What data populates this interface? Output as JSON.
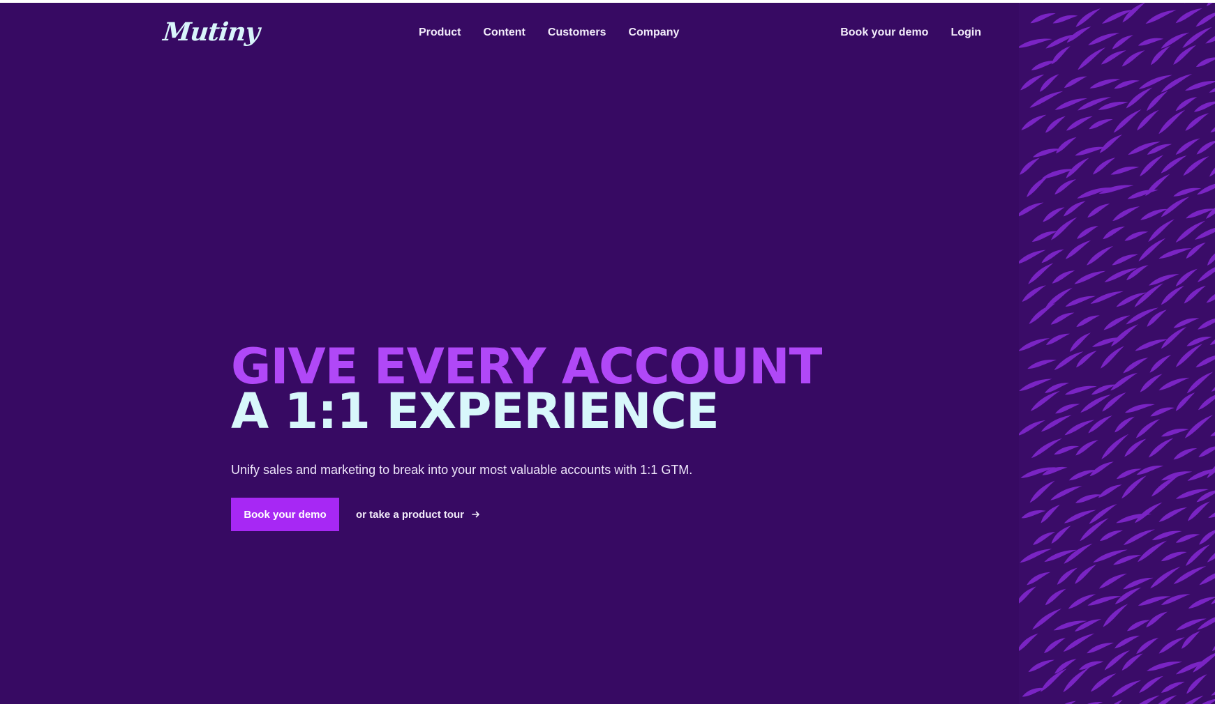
{
  "nav": {
    "logo_text": "Mutiny",
    "links": [
      "Product",
      "Content",
      "Customers",
      "Company"
    ],
    "right_links": [
      "Book your demo",
      "Login"
    ]
  },
  "hero": {
    "headline_line1": "GIVE EVERY ACCOUNT",
    "headline_line2": "A 1:1 EXPERIENCE",
    "subheading": "Unify sales and marketing to break into your most valuable accounts with 1:1 GTM.",
    "primary_cta": "Book your demo",
    "secondary_cta": "or take a product tour"
  },
  "colors": {
    "background": "#370a63",
    "accent": "#a728f4",
    "headline_accent": "#b048f7",
    "headline_light": "#d8f7fb",
    "pattern": "#7a24c4"
  },
  "icons": {
    "secondary_cta_icon": "arrow-right-icon",
    "pattern": "flame-pattern"
  }
}
